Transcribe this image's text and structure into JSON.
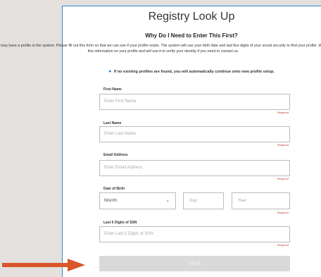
{
  "page": {
    "title": "Registry Look Up",
    "subtitle": "Why Do I Need to Enter This First?",
    "intro": "You may have a profile in the system. Please fill out this form so that we can see if your profile exists. The system will use your birth date and last five digits of your social security to find your profile. We store this information on your profile and will use it to verify your identity if you need to contact us.",
    "info_icon": "info-circle-icon",
    "info_text": "If no existing profiles are found, you will automatically continue onto new profile setup."
  },
  "form": {
    "first_name": {
      "label": "First Name",
      "placeholder": "Enter First Name",
      "required": "Required"
    },
    "last_name": {
      "label": "Last Name",
      "placeholder": "Enter Last Name",
      "required": "Required"
    },
    "email": {
      "label": "Email Address",
      "placeholder": "Enter Email Address",
      "required": "Required"
    },
    "dob": {
      "label": "Date of Birth",
      "month_value": "Month",
      "day_placeholder": "Day",
      "year_placeholder": "Year",
      "required": "Required"
    },
    "ssn": {
      "label": "Last 5 Digits of SSN",
      "placeholder": "Enter Last 5 Digits of SSN",
      "required": "Required"
    },
    "next_label": "Next"
  },
  "colors": {
    "accent": "#3d86c6",
    "arrow": "#d9562b",
    "required": "#c0392b",
    "button_disabled": "#d9d9d9"
  },
  "icons": {
    "month_dropdown": "chevron-down-icon",
    "pointer": "arrow-right-icon"
  }
}
